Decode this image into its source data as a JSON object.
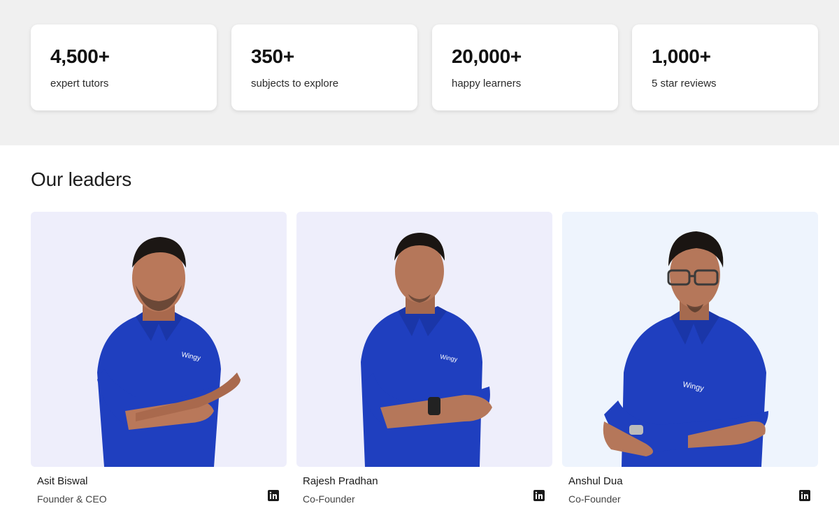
{
  "stats": [
    {
      "value": "4,500+",
      "label": "expert tutors"
    },
    {
      "value": "350+",
      "label": "subjects to explore"
    },
    {
      "value": "20,000+",
      "label": "happy learners"
    },
    {
      "value": "1,000+",
      "label": "5 star reviews"
    }
  ],
  "leaders_section": {
    "title": "Our leaders",
    "leaders": [
      {
        "name": "Asit Biswal",
        "role": "Founder & CEO",
        "shirt_logo": "Wingy",
        "icon": "linkedin-icon"
      },
      {
        "name": "Rajesh Pradhan",
        "role": "Co-Founder",
        "shirt_logo": "Wingy",
        "icon": "linkedin-icon"
      },
      {
        "name": "Anshul Dua",
        "role": "Co-Founder",
        "shirt_logo": "Wingy",
        "icon": "linkedin-icon"
      }
    ]
  },
  "colors": {
    "band_bg": "#f0f0f0",
    "photo_bg_1": "#eeeefb",
    "photo_bg_2": "#eeeefb",
    "photo_bg_3": "#eef4fd",
    "shirt_blue": "#1f3fbf"
  }
}
